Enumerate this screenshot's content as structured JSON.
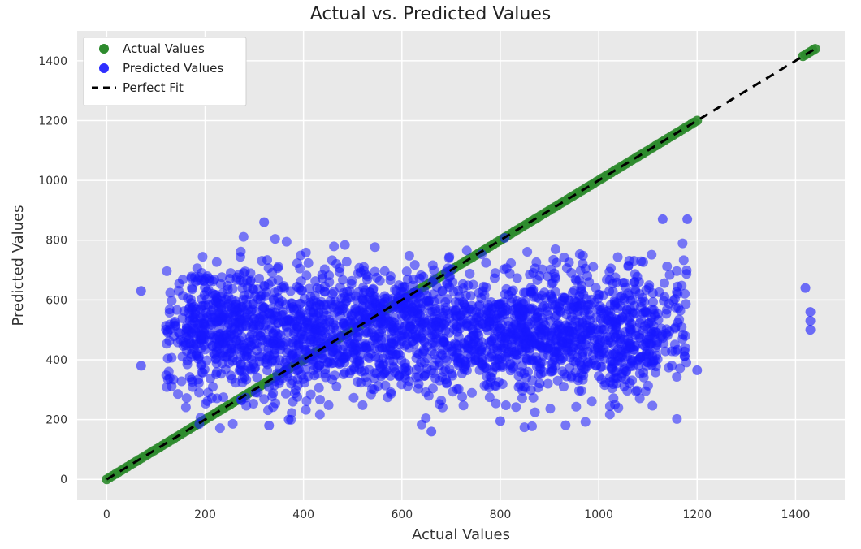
{
  "chart_data": {
    "type": "scatter",
    "title": "Actual vs. Predicted Values",
    "xlabel": "Actual Values",
    "ylabel": "Predicted Values",
    "xlim": [
      -60,
      1500
    ],
    "ylim": [
      -70,
      1500
    ],
    "xticks": [
      0,
      200,
      400,
      600,
      800,
      1000,
      1200,
      1400
    ],
    "yticks": [
      0,
      200,
      400,
      600,
      800,
      1000,
      1200,
      1400
    ],
    "grid": true,
    "legend_position": "upper left",
    "legend": [
      "Actual Values",
      "Predicted Values",
      "Perfect Fit"
    ],
    "perfect_fit_line": {
      "x": [
        0,
        1440
      ],
      "y": [
        0,
        1440
      ]
    },
    "note_on_data": "The screenshot shows a very dense scatter (thousands of points). The Actual Values series (green) lies exactly on y=x from roughly 0 to 1200 and ~1420–1440. The Predicted Values series (blue) forms a broad horizontal cloud centred around y≈450–550 spanning x≈60–1200 with outliers; the precise underlying data points are not individually readable.",
    "series": [
      {
        "name": "Actual Values",
        "color": "green",
        "marker": "circle",
        "description": "Points on the identity line y = x from ~0 to ~1200 and a small cluster near 1420–1440.",
        "sampled_points": [
          {
            "x": 0,
            "y": 0
          },
          {
            "x": 100,
            "y": 100
          },
          {
            "x": 200,
            "y": 200
          },
          {
            "x": 300,
            "y": 300
          },
          {
            "x": 400,
            "y": 400
          },
          {
            "x": 500,
            "y": 500
          },
          {
            "x": 600,
            "y": 600
          },
          {
            "x": 700,
            "y": 700
          },
          {
            "x": 800,
            "y": 800
          },
          {
            "x": 900,
            "y": 900
          },
          {
            "x": 1000,
            "y": 1000
          },
          {
            "x": 1100,
            "y": 1100
          },
          {
            "x": 1200,
            "y": 1200
          },
          {
            "x": 1420,
            "y": 1420
          },
          {
            "x": 1440,
            "y": 1440
          }
        ]
      },
      {
        "name": "Predicted Values",
        "color": "blue",
        "marker": "circle",
        "description": "Dense cloud, y mostly 250–780 across x 60–1200; outliers include (~70,380),(~70,630),(~320,860),(~330,180),(~660,160),(~800,195),(~1130,870),(~1180,870),(~1420,640),(~1430,500–560).",
        "approx_y_mean": 500,
        "approx_y_range": [
          160,
          870
        ],
        "approx_x_range": [
          60,
          1430
        ]
      },
      {
        "name": "Perfect Fit",
        "color": "black",
        "style": "dashed",
        "line": {
          "x": [
            0,
            1440
          ],
          "y": [
            0,
            1440
          ]
        }
      }
    ]
  }
}
